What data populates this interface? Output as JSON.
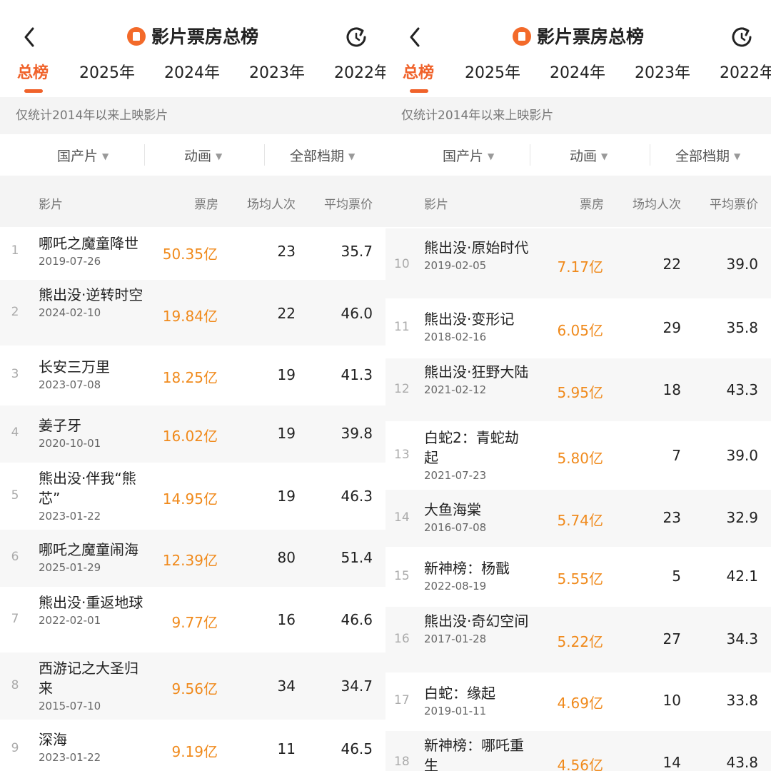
{
  "app": {
    "title": "影片票房总榜",
    "tabs": [
      "总榜",
      "2025年",
      "2024年",
      "2023年",
      "2022年"
    ],
    "notice": "仅统计2014年以来上映影片",
    "filters": [
      "国产片",
      "动画",
      "全部档期"
    ],
    "columns": [
      "影片",
      "票房",
      "场均人次",
      "平均票价"
    ],
    "icons": {
      "back": "back-arrow-icon",
      "refresh": "refresh-icon",
      "logo": "app-logo-icon",
      "caret": "caret-down-icon"
    },
    "colors": {
      "accent": "#f0622a",
      "box_office": "#f08a1c"
    }
  },
  "left_list": [
    {
      "rank": "1",
      "name": "哪吒之魔童降世",
      "date": "2019-07-26",
      "box": "50.35亿",
      "avg": "23",
      "price": "35.7"
    },
    {
      "rank": "2",
      "name": "熊出没·逆转时空",
      "date": "2024-02-10",
      "box": "19.84亿",
      "avg": "22",
      "price": "46.0"
    },
    {
      "rank": "3",
      "name": "长安三万里",
      "date": "2023-07-08",
      "box": "18.25亿",
      "avg": "19",
      "price": "41.3"
    },
    {
      "rank": "4",
      "name": "姜子牙",
      "date": "2020-10-01",
      "box": "16.02亿",
      "avg": "19",
      "price": "39.8"
    },
    {
      "rank": "5",
      "name": "熊出没·伴我“熊芯”",
      "date": "2023-01-22",
      "box": "14.95亿",
      "avg": "19",
      "price": "46.3"
    },
    {
      "rank": "6",
      "name": "哪吒之魔童闹海",
      "date": "2025-01-29",
      "box": "12.39亿",
      "avg": "80",
      "price": "51.4"
    },
    {
      "rank": "7",
      "name": "熊出没·重返地球",
      "date": "2022-02-01",
      "box": "9.77亿",
      "avg": "16",
      "price": "46.6"
    },
    {
      "rank": "8",
      "name": "西游记之大圣归来",
      "date": "2015-07-10",
      "box": "9.56亿",
      "avg": "34",
      "price": "34.7"
    },
    {
      "rank": "9",
      "name": "深海",
      "date": "2023-01-22",
      "box": "9.19亿",
      "avg": "11",
      "price": "46.5"
    }
  ],
  "right_list": [
    {
      "rank": "10",
      "name": "熊出没·原始时代",
      "date": "2019-02-05",
      "box": "7.17亿",
      "avg": "22",
      "price": "39.0"
    },
    {
      "rank": "11",
      "name": "熊出没·变形记",
      "date": "2018-02-16",
      "box": "6.05亿",
      "avg": "29",
      "price": "35.8"
    },
    {
      "rank": "12",
      "name": "熊出没·狂野大陆",
      "date": "2021-02-12",
      "box": "5.95亿",
      "avg": "18",
      "price": "43.3"
    },
    {
      "rank": "13",
      "name": "白蛇2：青蛇劫起",
      "date": "2021-07-23",
      "box": "5.80亿",
      "avg": "7",
      "price": "39.0"
    },
    {
      "rank": "14",
      "name": "大鱼海棠",
      "date": "2016-07-08",
      "box": "5.74亿",
      "avg": "23",
      "price": "32.9"
    },
    {
      "rank": "15",
      "name": "新神榜：杨戬",
      "date": "2022-08-19",
      "box": "5.55亿",
      "avg": "5",
      "price": "42.1"
    },
    {
      "rank": "16",
      "name": "熊出没·奇幻空间",
      "date": "2017-01-28",
      "box": "5.22亿",
      "avg": "27",
      "price": "34.3"
    },
    {
      "rank": "17",
      "name": "白蛇：缘起",
      "date": "2019-01-11",
      "box": "4.69亿",
      "avg": "10",
      "price": "33.8"
    },
    {
      "rank": "18",
      "name": "新神榜：哪吒重生",
      "date": "",
      "box": "4.56亿",
      "avg": "14",
      "price": "43.8"
    }
  ]
}
